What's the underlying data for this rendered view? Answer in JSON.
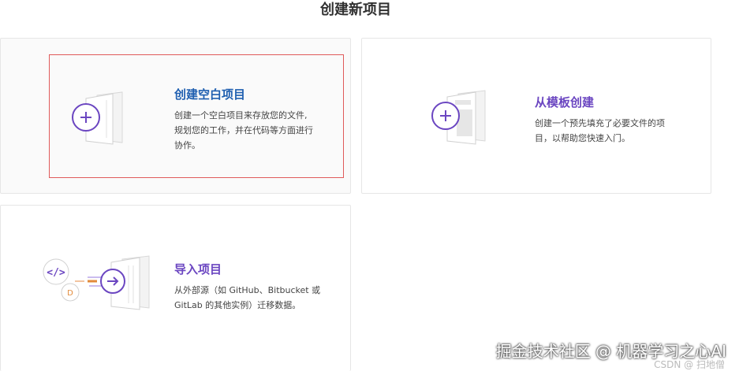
{
  "page": {
    "title": "创建新项目"
  },
  "cards": {
    "blank": {
      "heading": "创建空白项目",
      "description_line1": "创建一个空白项目来存放您的文件,",
      "description_line2": "规划您的工作，并在代码等方面进行",
      "description_line3": "协作。",
      "icon": "plus-document-icon"
    },
    "template": {
      "heading": "从模板创建",
      "description_line1": "创建一个预先填充了必要文件的项",
      "description_line2": "目，以帮助您快速入门。",
      "icon": "plus-template-icon"
    },
    "import": {
      "heading": "导入项目",
      "description_line1": "从外部源（如 GitHub、Bitbucket 或",
      "description_line2": "GitLab 的其他实例）迁移数据。",
      "icon": "import-arrow-icon"
    }
  },
  "watermark": {
    "text": "掘金技术社区 @ 机器学习之心AI",
    "sub": "CSDN @ 扫地僧"
  },
  "colors": {
    "accent_purple": "#6b46c1",
    "accent_blue": "#1f5fb0",
    "focus_red": "#e05a5a",
    "card_border": "#e6e6e6"
  }
}
